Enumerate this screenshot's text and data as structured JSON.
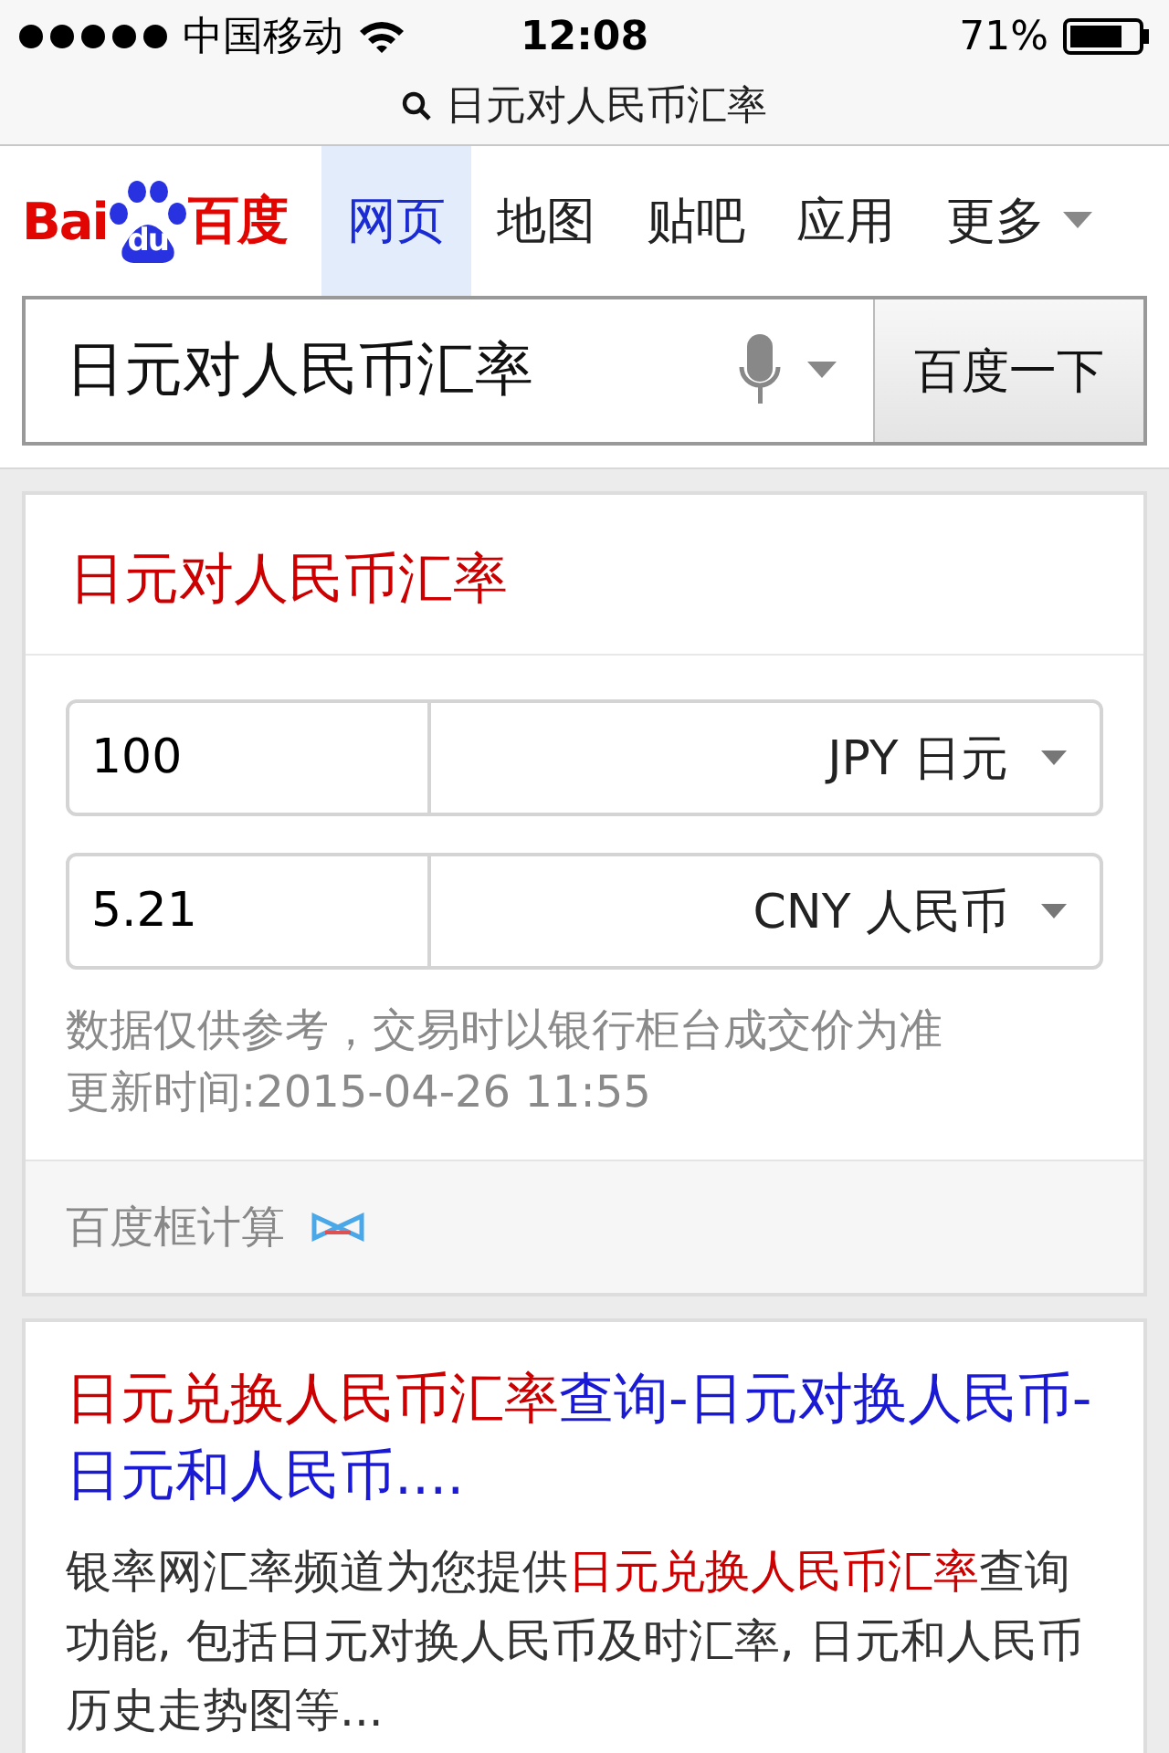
{
  "status_bar": {
    "carrier": "中国移动",
    "time": "12:08",
    "battery": "71%"
  },
  "address_bar": {
    "text": "日元对人民币汇率"
  },
  "logo": {
    "latin": "Bai",
    "badge": "du",
    "chinese": "百度"
  },
  "nav": {
    "tabs": [
      {
        "label": "网页",
        "selected": true
      },
      {
        "label": "地图",
        "selected": false
      },
      {
        "label": "贴吧",
        "selected": false
      },
      {
        "label": "应用",
        "selected": false
      },
      {
        "label": "更多",
        "selected": false,
        "kind": "dropdown"
      }
    ]
  },
  "search": {
    "value": "日元对人民币汇率",
    "button": "百度一下"
  },
  "converter": {
    "title": "日元对人民币汇率",
    "rows": [
      {
        "amount": "100",
        "currency": "JPY 日元"
      },
      {
        "amount": "5.21",
        "currency": "CNY 人民币"
      }
    ],
    "note": "数据仅供参考，交易时以银行柜台成交价为准",
    "updated": "更新时间:2015-04-26 11:55",
    "footer": "百度框计算"
  },
  "results": [
    {
      "title": [
        {
          "text": "日元兑换人民币汇率",
          "highlight": true
        },
        {
          "text": "查询-日元对换人民币-日元和人民币....",
          "highlight": false
        }
      ],
      "snippet": [
        {
          "text": "银率网汇率频道为您提供",
          "highlight": false
        },
        {
          "text": "日元兑换人民币汇率",
          "highlight": true
        },
        {
          "text": "查询功能, 包括日元对换人民币及时汇率, 日元和人民币历史走势图等...",
          "highlight": false
        }
      ]
    }
  ]
}
